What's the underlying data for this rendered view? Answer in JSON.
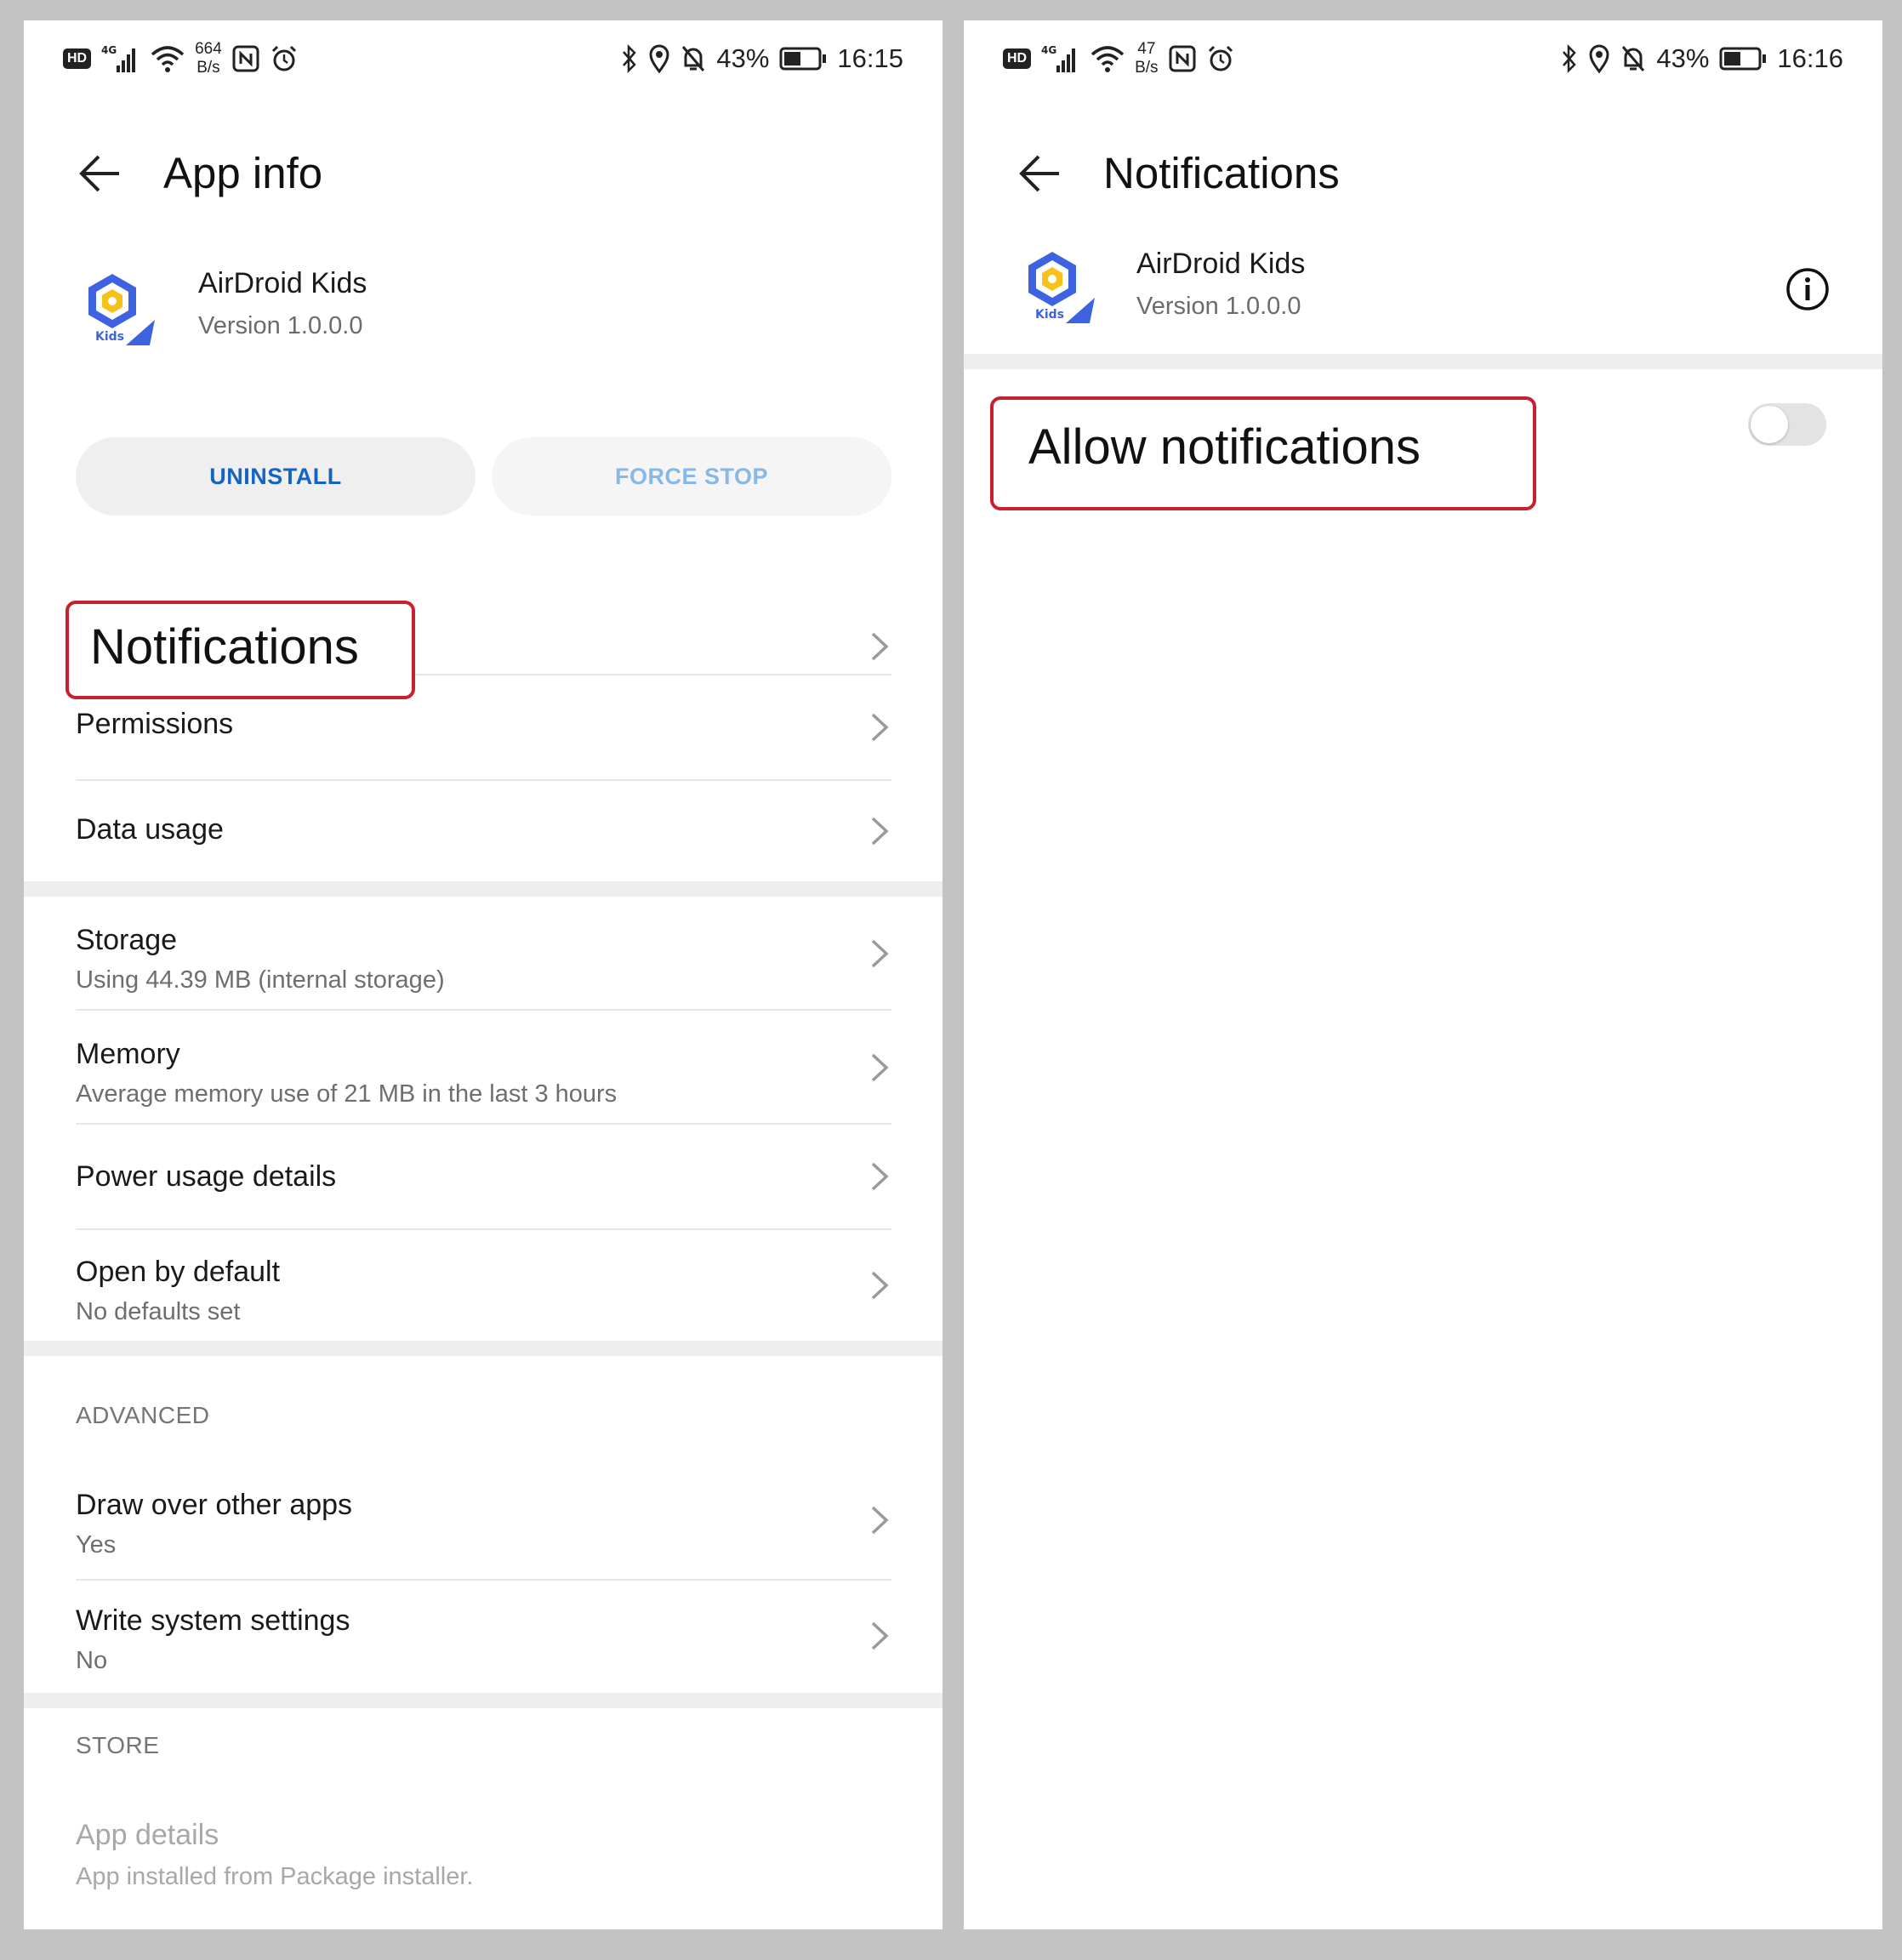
{
  "left_screen": {
    "status": {
      "hd": "HD",
      "net_type": "4G",
      "rate_value": "664",
      "rate_unit": "B/s",
      "battery": "43%",
      "time": "16:15"
    },
    "title": "App info",
    "app": {
      "name": "AirDroid Kids",
      "version": "Version 1.0.0.0",
      "icon_text": "Kids"
    },
    "buttons": {
      "uninstall": "UNINSTALL",
      "force_stop": "FORCE STOP"
    },
    "rows": {
      "notifications": "Notifications",
      "permissions": "Permissions",
      "data_usage": "Data usage",
      "storage": {
        "title": "Storage",
        "sub": "Using 44.39 MB (internal storage)"
      },
      "memory": {
        "title": "Memory",
        "sub": "Average memory use of 21 MB in the last 3 hours"
      },
      "power": "Power usage details",
      "open_default": {
        "title": "Open by default",
        "sub": "No defaults set"
      }
    },
    "advanced": {
      "header": "ADVANCED",
      "draw_over": {
        "title": "Draw over other apps",
        "sub": "Yes"
      },
      "write_settings": {
        "title": "Write system settings",
        "sub": "No"
      }
    },
    "store": {
      "header": "STORE",
      "app_details": {
        "title": "App details",
        "sub": "App installed from Package installer."
      }
    }
  },
  "right_screen": {
    "status": {
      "hd": "HD",
      "net_type": "4G",
      "rate_value": "47",
      "rate_unit": "B/s",
      "battery": "43%",
      "time": "16:16"
    },
    "title": "Notifications",
    "app": {
      "name": "AirDroid Kids",
      "version": "Version 1.0.0.0",
      "icon_text": "Kids"
    },
    "allow_notifications": {
      "label": "Allow notifications",
      "enabled": false
    }
  },
  "colors": {
    "highlight": "#c8202e",
    "accent_blue": "#1565c0",
    "disabled_blue": "#86b8e8",
    "background": "#c3c3c3"
  }
}
